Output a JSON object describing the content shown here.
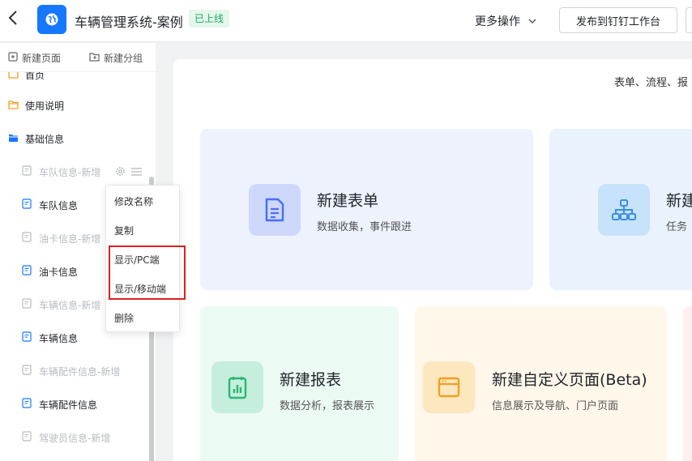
{
  "header": {
    "back_icon": "chevron-left-icon",
    "app_icon": "globe-icon",
    "app_title": "车辆管理系统-案例",
    "status_badge": "已上线",
    "more_ops": "更多操作",
    "publish_button": "发布到钉钉工作台",
    "brand_color": "#1677ff"
  },
  "sidebar": {
    "toolbar": {
      "new_page": "新建页面",
      "new_group": "新建分组"
    },
    "partial_item": "首页",
    "items": [
      {
        "label": "使用说明",
        "icon": "folder-icon",
        "dim": false
      },
      {
        "label": "基础信息",
        "icon": "folder-open-icon",
        "dim": false
      },
      {
        "label": "车队信息-新增",
        "icon": "form-icon",
        "dim": true
      },
      {
        "label": "车队信息",
        "icon": "form-icon",
        "dim": false
      },
      {
        "label": "油卡信息-新增",
        "icon": "form-icon",
        "dim": true
      },
      {
        "label": "油卡信息",
        "icon": "form-icon",
        "dim": false
      },
      {
        "label": "车辆信息-新增",
        "icon": "form-icon",
        "dim": true
      },
      {
        "label": "车辆信息",
        "icon": "form-icon",
        "dim": false
      },
      {
        "label": "车辆配件信息-新增",
        "icon": "form-icon",
        "dim": true
      },
      {
        "label": "车辆配件信息",
        "icon": "form-icon",
        "dim": false
      },
      {
        "label": "驾驶员信息-新增",
        "icon": "form-icon",
        "dim": true
      }
    ]
  },
  "context_menu": {
    "items": [
      "修改名称",
      "复制",
      "显示/PC端",
      "显示/移动端",
      "删除"
    ],
    "highlighted": [
      "显示/PC端",
      "显示/移动端"
    ],
    "highlight_color": "#e02020"
  },
  "main": {
    "hint": "表单、流程、报",
    "cards": [
      {
        "title": "新建表单",
        "subtitle": "数据收集，事件跟进",
        "icon": "document-icon",
        "bg": "#eef2fd",
        "icon_bg": "#cdd8fb",
        "icon_color": "#4a6cf7"
      },
      {
        "title": "新建",
        "subtitle": "任务",
        "icon": "org-chart-icon",
        "bg": "#eaf3fd",
        "icon_bg": "#c7e2fb",
        "icon_color": "#3a8ee6"
      },
      {
        "title": "新建报表",
        "subtitle": "数据分析，报表展示",
        "icon": "chart-icon",
        "bg": "#ecfaf4",
        "icon_bg": "#c5efdc",
        "icon_color": "#2bb673"
      },
      {
        "title": "新建自定义页面(Beta)",
        "subtitle": "信息展示及导航、门户页面",
        "icon": "browser-window-icon",
        "bg": "#fff7ea",
        "icon_bg": "#fde7bf",
        "icon_color": "#f0a020"
      }
    ]
  }
}
